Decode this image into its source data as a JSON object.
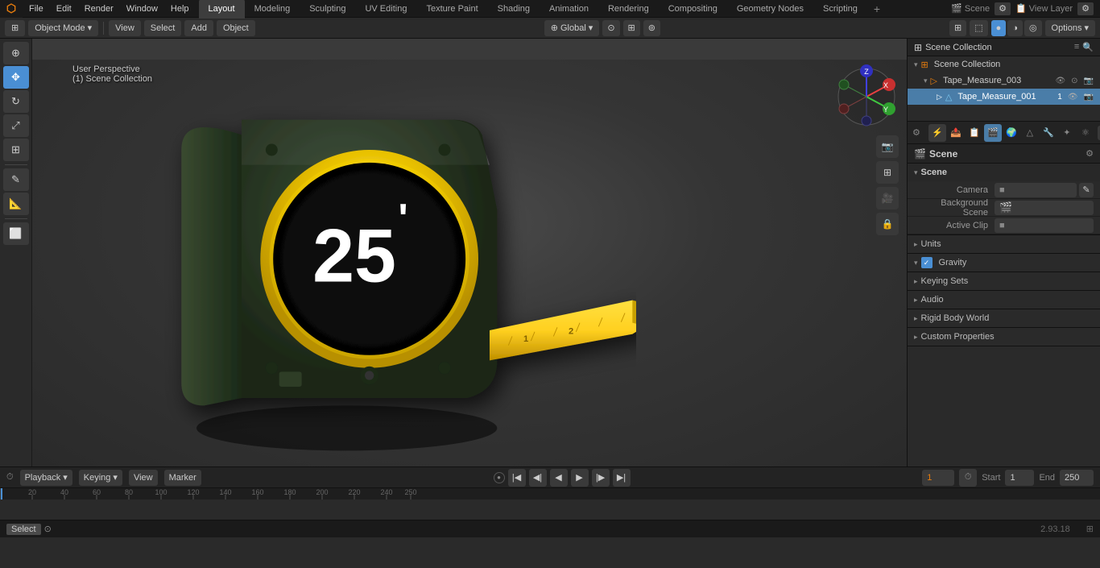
{
  "topMenu": {
    "items": [
      "File",
      "Edit",
      "Render",
      "Window",
      "Help"
    ]
  },
  "workspaceTabs": {
    "tabs": [
      "Layout",
      "Modeling",
      "Sculpting",
      "UV Editing",
      "Texture Paint",
      "Shading",
      "Animation",
      "Rendering",
      "Compositing",
      "Geometry Nodes",
      "Scripting"
    ],
    "activeTab": "Layout"
  },
  "viewportHeader": {
    "objectMode": "Object Mode",
    "view": "View",
    "select": "Select",
    "add": "Add",
    "object": "Object",
    "transform": "Global",
    "options": "Options"
  },
  "viewportInfo": {
    "perspective": "User Perspective",
    "collection": "(1) Scene Collection"
  },
  "outliner": {
    "title": "Scene Collection",
    "items": [
      {
        "name": "Tape_Measure_003",
        "type": "object",
        "indent": 1
      },
      {
        "name": "Tape_Measure_001",
        "type": "mesh",
        "indent": 2,
        "frameNum": "1"
      }
    ]
  },
  "sceneProps": {
    "header": "Scene",
    "title": "Scene",
    "sections": {
      "scene": {
        "label": "Scene",
        "camera": "Camera",
        "backgroundScene": "Background Scene",
        "activeClip": "Active Clip"
      },
      "units": "Units",
      "gravity": "Gravity",
      "gravityEnabled": true,
      "keyingSets": "Keying Sets",
      "audio": "Audio",
      "rigidBodyWorld": "Rigid Body World",
      "customProperties": "Custom Properties"
    }
  },
  "timeline": {
    "playback": "Playback",
    "keying": "Keying",
    "view": "View",
    "marker": "Marker",
    "currentFrame": "1",
    "startFrame": "1",
    "endFrame": "250",
    "startLabel": "Start",
    "endLabel": "End"
  },
  "statusBar": {
    "left": "Select",
    "right": "2.93.18",
    "version": "2.93.18"
  },
  "icons": {
    "arrow": "▸",
    "arrowDown": "▾",
    "arrowRight": "▸",
    "check": "✓",
    "camera": "📷",
    "scene": "🎬",
    "film": "🎞",
    "circle": "●",
    "x": "✕",
    "dot": "•",
    "render": "⚡",
    "chain": "⛓",
    "cursor": "⊕",
    "move": "✥",
    "rotate": "↻",
    "scale": "⤢",
    "transform": "⊞",
    "measure": "📐",
    "eye": "👁",
    "lock": "🔒",
    "plus": "+",
    "minus": "−",
    "search": "🔍",
    "filter": "≡",
    "settings": "⚙",
    "pin": "📌",
    "expand": "⊞",
    "collapse": "⊟",
    "grid": "▦",
    "sphere": "⊙",
    "light": "☀",
    "world": "⊕",
    "obj": "△",
    "anim": "∿"
  }
}
